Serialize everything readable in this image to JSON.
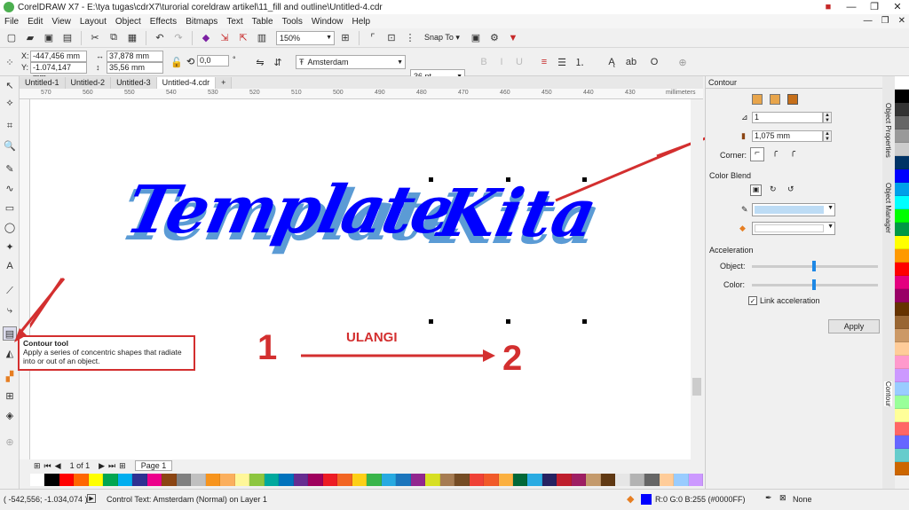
{
  "window": {
    "title": "CorelDRAW X7 - E:\\tya tugas\\cdrX7\\turorial coreldraw artikel\\11_fill and outline\\Untitled-4.cdr"
  },
  "menu": [
    "File",
    "Edit",
    "View",
    "Layout",
    "Object",
    "Effects",
    "Bitmaps",
    "Text",
    "Table",
    "Tools",
    "Window",
    "Help"
  ],
  "standard_bar": {
    "zoom": "150%",
    "snap_to": "Snap To"
  },
  "property_bar": {
    "x_label": "X:",
    "x_value": "-447,456 mm",
    "y_label": "Y:",
    "y_value": "-1.074,147 mm",
    "width_value": "37,878 mm",
    "height_value": "35,56 mm",
    "rotation_value": "0,0",
    "rotation_unit": "°",
    "font_name": "Amsterdam",
    "font_size": "36 pt"
  },
  "doc_tabs": [
    "Untitled-1",
    "Untitled-2",
    "Untitled-3",
    "Untitled-4.cdr"
  ],
  "ruler": {
    "ticks": [
      "570",
      "560",
      "550",
      "540",
      "530",
      "520",
      "510",
      "500",
      "490",
      "480",
      "470",
      "460",
      "450",
      "440",
      "430"
    ],
    "unit": "millimeters"
  },
  "canvas": {
    "text1": "Template",
    "text2": "Kita",
    "label_1": "1",
    "label_2": "2",
    "annotation": "ULANGI",
    "fill_color": "#0000FF",
    "contour_color": "#5B9BD5"
  },
  "tooltip": {
    "title": "Contour tool",
    "body": "Apply a series of concentric shapes that radiate into or out of an object."
  },
  "page_nav": {
    "of": "1 of 1",
    "page_tab": "Page 1"
  },
  "docker": {
    "title": "Contour",
    "steps_value": "1",
    "offset_value": "1,075 mm",
    "corner_label": "Corner:",
    "color_blend_label": "Color Blend",
    "acceleration_label": "Acceleration",
    "object_label": "Object:",
    "color_label": "Color:",
    "link_label": "Link acceleration",
    "apply_label": "Apply",
    "outline_swatch": "#BDDCF5",
    "fill_swatch": "#FFFFFF"
  },
  "vertical_tabs": [
    "Object Properties",
    "Object Manager",
    "Contour"
  ],
  "status": {
    "coords": "( -542,556; -1.034,074 )",
    "message": "Control Text: Amsterdam (Normal) on Layer 1",
    "color_info": "R:0 G:0 B:255 (#0000FF)",
    "outline": "None"
  },
  "palette": [
    "#ffffff",
    "#000000",
    "#ff0000",
    "#ff6600",
    "#ffff00",
    "#00a651",
    "#00aeef",
    "#2e3192",
    "#ec008c",
    "#8b4513",
    "#808080",
    "#c0c0c0",
    "#f7941d",
    "#fbaf5d",
    "#fff799",
    "#8dc63f",
    "#00a99d",
    "#0072bc",
    "#662d91",
    "#9e005d",
    "#ed1c24",
    "#f26522",
    "#fdd017",
    "#39b54a",
    "#27aae1",
    "#1b75bc",
    "#92278f",
    "#d7df23",
    "#a67c52",
    "#754c24",
    "#ef4136",
    "#f15a29",
    "#fbb040",
    "#006838",
    "#29abe2",
    "#262262",
    "#be1e2d",
    "#9e1f63",
    "#c49a6c",
    "#603913",
    "#e6e6e6",
    "#b3b3b3",
    "#666666",
    "#ffcc99",
    "#99ccff",
    "#cc99ff"
  ],
  "vpalette": [
    "#ffffff",
    "#000000",
    "#333333",
    "#666666",
    "#999999",
    "#cccccc",
    "#003366",
    "#0000ff",
    "#00a0e9",
    "#00ffff",
    "#00ff00",
    "#009944",
    "#ffff00",
    "#ff9900",
    "#ff0000",
    "#e4007f",
    "#990066",
    "#663300",
    "#996633",
    "#cc9966",
    "#ffcc99",
    "#ff99cc",
    "#cc99ff",
    "#99ccff",
    "#99ff99",
    "#ffff99",
    "#ff6666",
    "#6666ff",
    "#66cccc",
    "#cc6600"
  ]
}
